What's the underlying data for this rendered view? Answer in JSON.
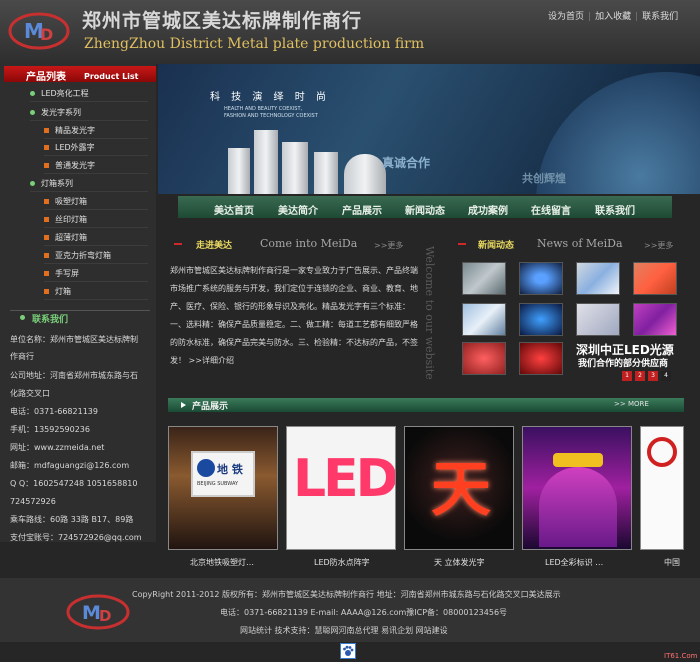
{
  "header": {
    "title_cn": "郑州市管城区美达标牌制作商行",
    "title_en": "ZhengZhou District Metal plate production firm",
    "links": [
      "设为首页",
      "加入收藏",
      "联系我们"
    ]
  },
  "sidebar": {
    "product_list_cn": "产品列表",
    "product_list_en": "Product List",
    "categories": [
      {
        "label": "LED亮化工程",
        "level": 1
      },
      {
        "label": "发光字系列",
        "level": 1
      },
      {
        "label": "精品发光字",
        "level": 2
      },
      {
        "label": "LED外露字",
        "level": 2
      },
      {
        "label": "普通发光字",
        "level": 2
      },
      {
        "label": "灯箱系列",
        "level": 1
      },
      {
        "label": "吸塑灯箱",
        "level": 2
      },
      {
        "label": "丝印灯箱",
        "level": 2
      },
      {
        "label": "超薄灯箱",
        "level": 2
      },
      {
        "label": "亚克力折弯灯箱",
        "level": 2
      },
      {
        "label": "手写屏",
        "level": 2
      },
      {
        "label": "灯箱",
        "level": 2
      }
    ],
    "contact_title": "联系我们",
    "contact_lines": [
      "单位名称：郑州市管城区美达标牌制",
      "作商行",
      "公司地址：河南省郑州市城东路与石",
      "化路交叉口",
      "电话：0371-66821139",
      "手机：13592590236",
      "网址：www.zzmeida.net",
      "邮箱：mdfaguangzi@126.com",
      "Q Q：1602547248 1051658810",
      "      724572926",
      "乘车路线：60路 33路 B17、89路",
      "支付宝账号：724572926@qq.com"
    ]
  },
  "banner": {
    "tech": "科 技  演 绎  时 尚",
    "caption1": "HEALTH AND BEAUTY COEXIST,",
    "caption2": "FASHION AND TECHNOLOGY COEXIST",
    "slogan1": "真诚合作",
    "slogan2": "共创辉煌"
  },
  "nav": [
    "美达首页",
    "美达简介",
    "产品展示",
    "新闻动态",
    "成功案例",
    "在线留言",
    "联系我们"
  ],
  "about": {
    "title_cn": "走进美达",
    "title_en": "Come into MeiDa",
    "more": ">>更多",
    "text": "郑州市管城区美达标牌制作商行是一家专业致力于广告展示、产品终端市场推广系统的服务与开发，我们定位于连锁的企业、商业、教育、地产、医疗、保险、银行的形象导识及亮化。精品发光字有三个标准：一、选料精：确保产品质量稳定。二、做工精：每道工艺都有细致严格的防水标准，确保产品完美与防水。三、检验精：不达标的产品，不签发！ >>详细介绍",
    "side_text": "Welcome to our website"
  },
  "news": {
    "title_cn": "新闻动态",
    "title_en": "News of MeiDa",
    "more": ">>更多",
    "promo1": "深圳中正LED光源",
    "promo2": "我们合作的部分供应商",
    "pages": [
      "1",
      "2",
      "3",
      "4"
    ]
  },
  "products": {
    "title": "产品展示",
    "more": ">> MORE",
    "items": [
      {
        "caption": "北京地铁吸塑灯…",
        "sign_text": "地 铁",
        "sign_sub": "BEIJING SUBWAY"
      },
      {
        "caption": "LED防水点阵字",
        "sign_text": "LED"
      },
      {
        "caption": "天 立体发光字",
        "sign_text": "天"
      },
      {
        "caption": "LED全彩标识 …",
        "sign_text": ""
      },
      {
        "caption": "中国",
        "sign_text": ""
      }
    ]
  },
  "footer": {
    "line1": "CopyRight 2011-2012 版权所有：郑州市管城区美达标牌制作商行 地址：河南省郑州市城东路与石化路交叉口美达展示",
    "line2": "电话：0371-66821139 E-mail: AAAA@126.com豫ICP备：08000123456号",
    "line3": "网站统计 技术支持：慧聪网河南总代理 易讯企划 网站建设",
    "watermark": "IT61.Com"
  },
  "colors": {
    "accent_red": "#c81818",
    "nav_green": "#2a5a44",
    "title_yellow": "#e8d860"
  }
}
